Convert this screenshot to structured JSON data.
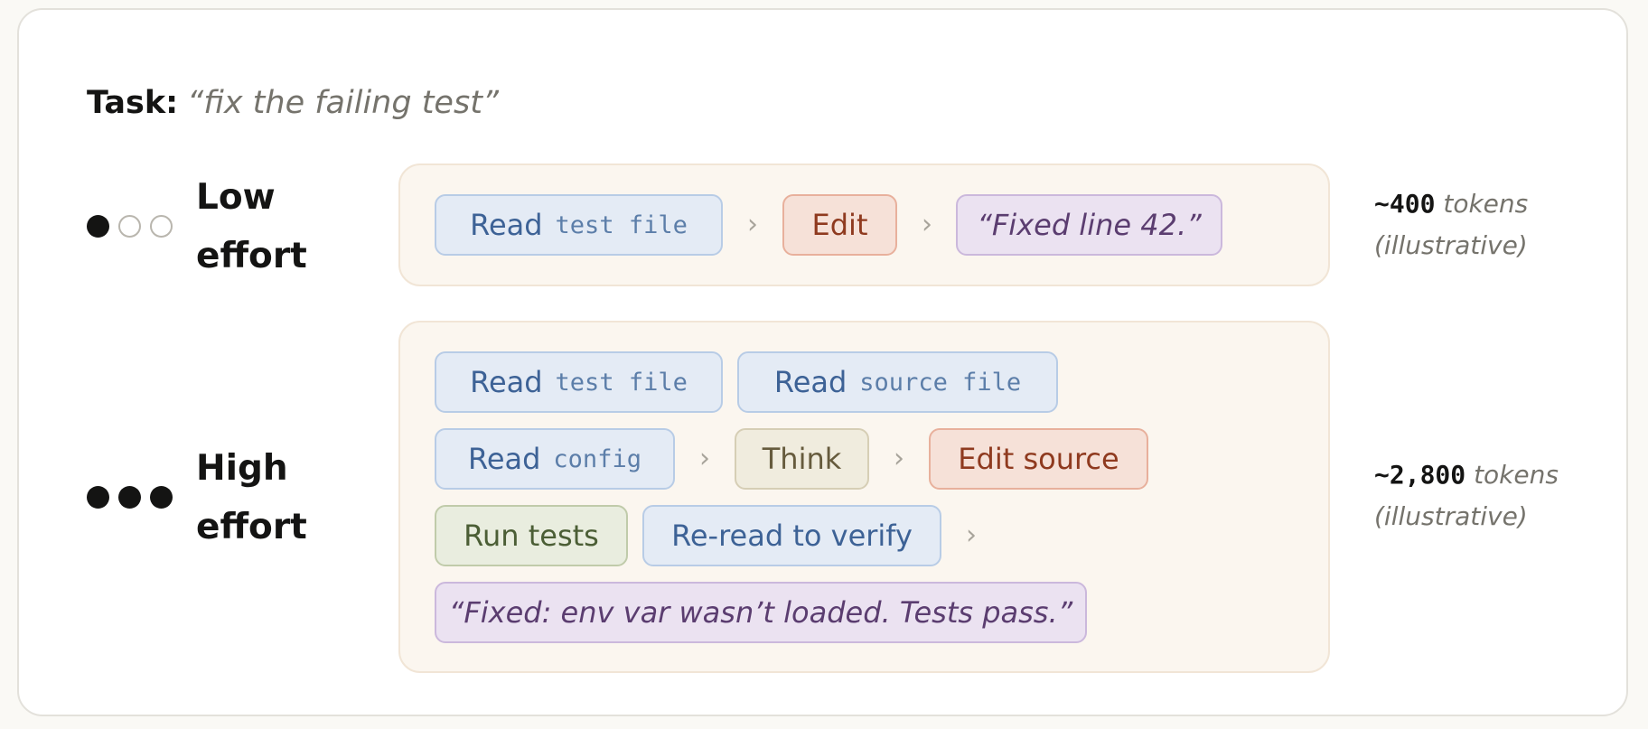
{
  "task": {
    "label": "Task:",
    "quote": "“fix the failing test”"
  },
  "low": {
    "effort_line1": "Low",
    "effort_line2": "effort",
    "dots_filled": 1,
    "dots_total": 3,
    "steps": {
      "read": {
        "verb": "Read",
        "object": "test file"
      },
      "edit": "Edit",
      "reply": "“Fixed line 42.”"
    },
    "tokens": {
      "amount": "~400",
      "unit": "tokens",
      "note": "(illustrative)"
    }
  },
  "high": {
    "effort_line1": "High",
    "effort_line2": "effort",
    "dots_filled": 3,
    "dots_total": 3,
    "steps": {
      "read_test": {
        "verb": "Read",
        "object": "test file"
      },
      "read_source": {
        "verb": "Read",
        "object": "source file"
      },
      "read_config": {
        "verb": "Read",
        "object": "config"
      },
      "think": "Think",
      "edit_source": "Edit source",
      "run_tests": "Run tests",
      "reread": "Re-read to verify",
      "reply": "“Fixed: env var wasn’t loaded. Tests pass.”"
    },
    "tokens": {
      "amount": "~2,800",
      "unit": "tokens",
      "note": "(illustrative)"
    }
  },
  "separator": "›",
  "colors": {
    "read": "#3d6296",
    "edit": "#8f3a1f",
    "reply": "#5b3d70",
    "think": "#665b3d",
    "run": "#4b5e35"
  }
}
